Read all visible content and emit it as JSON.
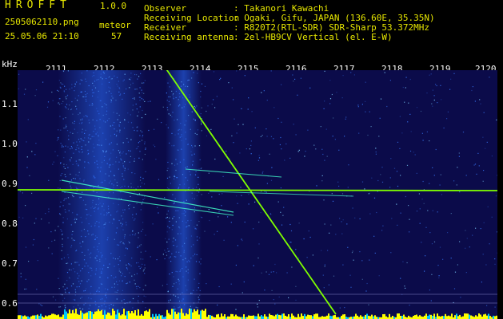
{
  "app": {
    "title": "HROFFT",
    "version": "1.0.0"
  },
  "file": {
    "name": "2505062110.png",
    "datetime": "25.05.06 21:10"
  },
  "event": {
    "label": "meteor",
    "count": "57"
  },
  "info": [
    {
      "label": "Observer",
      "value": ": Takanori Kawachi"
    },
    {
      "label": "Receiving Location",
      "value": ": Ogaki, Gifu, JAPAN (136.60E, 35.35N)"
    },
    {
      "label": "Receiver",
      "value": ": R820T2(RTL-SDR) SDR-Sharp 53.372MHz"
    },
    {
      "label": "Receiving antenna",
      "value": ": 2el-HB9CV Vertical (el. E-W)"
    }
  ],
  "axes": {
    "ylabel": "kHz",
    "yticks": [
      "1.1",
      "1.0",
      "0.9",
      "0.8",
      "0.7",
      "0.6"
    ],
    "xticks": [
      "2111",
      "2112",
      "2113",
      "2114",
      "2115",
      "2116",
      "2117",
      "2118",
      "2119",
      "2120"
    ]
  },
  "colors": {
    "background": "#0b0b4a",
    "trace": "#7fff00",
    "noise": "#2a6cff",
    "baseline": "#ffff00"
  }
}
